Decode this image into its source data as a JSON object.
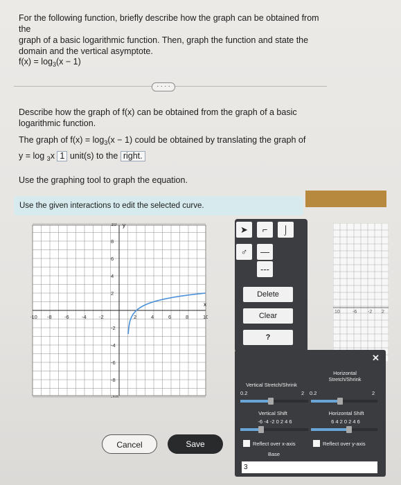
{
  "question": {
    "line1": "For the following function, briefly describe how the graph can be obtained from the",
    "line2": "graph of a basic logarithmic function. Then, graph the function and state the",
    "line3": "domain and the vertical asymptote."
  },
  "function": {
    "prefix": "f(x) = log",
    "base": "3",
    "arg": "(x − 1)"
  },
  "more_button": "· · · ·",
  "describe": {
    "line1": "Describe how the graph of f(x) can be obtained from the graph of a basic",
    "line2": "logarithmic function."
  },
  "statement": {
    "part1": "The graph of f(x) = log",
    "base": "3",
    "part2": "(x − 1) could be obtained by translating the graph of",
    "y_prefix": "y = log",
    "y_base": "3",
    "y_var": "x",
    "answer_units": "1",
    "units_text": "unit(s) to the",
    "answer_dir": "right."
  },
  "instruction": "Use the graphing tool to graph the equation.",
  "banner": "Use the given interactions to edit the selected curve.",
  "graph": {
    "y_label": "y",
    "x_label": "x",
    "x_ticks": [
      "-10",
      "-8",
      "-6",
      "-4",
      "-2",
      "2",
      "4",
      "6",
      "8",
      "10"
    ],
    "y_ticks": [
      "10",
      "8",
      "6",
      "4",
      "2",
      "-2",
      "-4",
      "-6",
      "-8",
      "-10"
    ],
    "curve_color": "#4a90d9"
  },
  "tools": {
    "delete": "Delete",
    "clear": "Clear",
    "help": "?",
    "dots": "---"
  },
  "right_graph": {
    "ticks": [
      "10",
      "-6",
      "-2",
      "2"
    ]
  },
  "popup": {
    "close": "✕",
    "horizontal_stretch": "Horizontal Stretch/Shrink",
    "vertical_stretch": "Vertical Stretch/Shrink",
    "vs_min": "0.2",
    "vs_max": "2",
    "hs_min": "0.2",
    "hs_max": "2",
    "vertical_shift": "Vertical Shift",
    "horizontal_shift": "Horizontal Shift",
    "vshift_ticks": "-6  -4  -2   0   2   4   6",
    "hshift_ticks": "6  4  2  0  2  4  6",
    "reflect_x": "Reflect over x-axis",
    "reflect_y": "Reflect over y-axis",
    "base_label": "Base",
    "base_value": "3"
  },
  "buttons": {
    "cancel": "Cancel",
    "save": "Save"
  }
}
